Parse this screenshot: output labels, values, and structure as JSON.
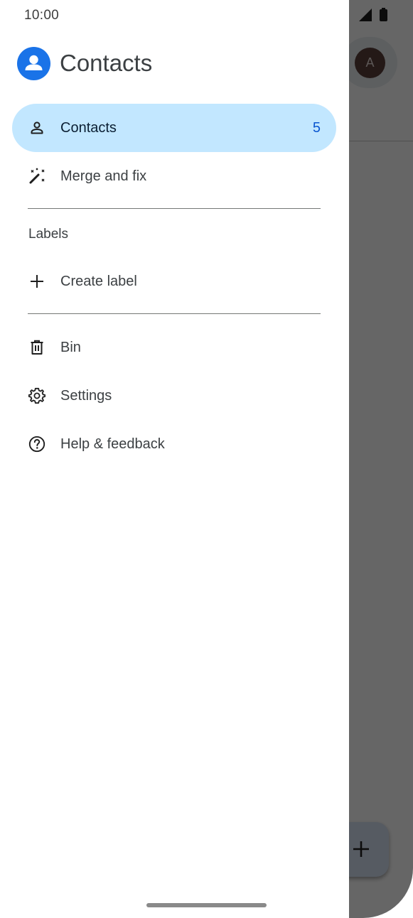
{
  "status_bar": {
    "time": "10:00"
  },
  "drawer": {
    "app_title": "Contacts",
    "app_icon": "contacts-person-icon",
    "items": [
      {
        "label": "Contacts",
        "count": "5",
        "icon": "person-icon",
        "active": true
      },
      {
        "label": "Merge and fix",
        "icon": "magic-wand-icon",
        "active": false
      }
    ],
    "labels_section": {
      "heading": "Labels",
      "create_label": "Create label",
      "create_icon": "plus-icon"
    },
    "bottom_items": [
      {
        "label": "Bin",
        "icon": "trash-icon"
      },
      {
        "label": "Settings",
        "icon": "gear-icon"
      },
      {
        "label": "Help & feedback",
        "icon": "help-circle-icon"
      }
    ]
  },
  "background": {
    "avatar_letter": "A",
    "fab_icon": "plus-icon"
  },
  "colors": {
    "active_item_bg": "#c2e7ff",
    "count_color": "#0b57d0",
    "logo_blue": "#1a73e8"
  }
}
